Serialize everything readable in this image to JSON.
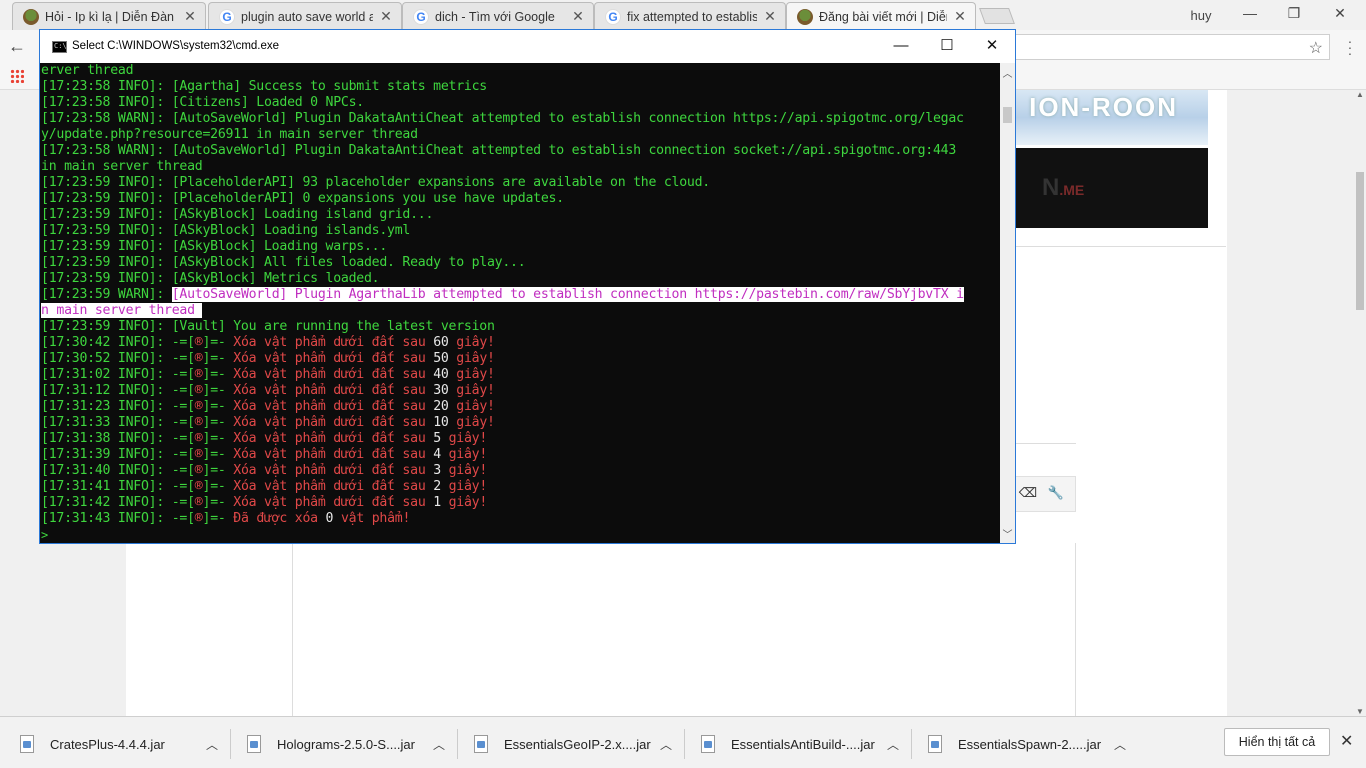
{
  "browser": {
    "tabs": [
      {
        "title": "Hỏi - Ip kì lạ | Diễn Đàn M",
        "favicon": "minecraft-icon"
      },
      {
        "title": "plugin auto save world at",
        "favicon": "google-icon"
      },
      {
        "title": "dich - Tìm với Google",
        "favicon": "google-icon"
      },
      {
        "title": "fix attempted to establish",
        "favicon": "google-icon"
      },
      {
        "title": "Đăng bài viết mới | Diễn Đ",
        "favicon": "minecraft-icon"
      }
    ],
    "profile_name": "huy",
    "window_controls": {
      "minimize": "—",
      "restore": "❐",
      "close": "✕"
    }
  },
  "page": {
    "banner_text": "ION-ROON",
    "banner_sub": "N",
    "banner_me": ".ME"
  },
  "cmd": {
    "title": "Select C:\\WINDOWS\\system32\\cmd.exe",
    "icon_text": "C:\\",
    "controls": {
      "minimize": "—",
      "maximize": "☐",
      "close": "✕"
    },
    "prompt": ">",
    "lines": [
      [
        {
          "t": "erver thread",
          "c": "green"
        }
      ],
      [
        {
          "t": "[17:23:58 INFO]: [Agartha] Success to submit stats metrics",
          "c": "green"
        }
      ],
      [
        {
          "t": "[17:23:58 INFO]: [Citizens] Loaded 0 NPCs.",
          "c": "green"
        }
      ],
      [
        {
          "t": "[17:23:58 WARN]: [AutoSaveWorld] Plugin DakataAntiCheat attempted to establish connection https://api.spigotmc.org/legac",
          "c": "green"
        }
      ],
      [
        {
          "t": "y/update.php?resource=26911 in main server thread",
          "c": "green"
        }
      ],
      [
        {
          "t": "[17:23:58 WARN]: [AutoSaveWorld] Plugin DakataAntiCheat attempted to establish connection socket://api.spigotmc.org:443",
          "c": "green"
        }
      ],
      [
        {
          "t": "in main server thread",
          "c": "green"
        }
      ],
      [
        {
          "t": "[17:23:59 INFO]: [PlaceholderAPI] 93 placeholder expansions are available on the cloud.",
          "c": "green"
        }
      ],
      [
        {
          "t": "[17:23:59 INFO]: [PlaceholderAPI] 0 expansions you use have updates.",
          "c": "green"
        }
      ],
      [
        {
          "t": "[17:23:59 INFO]: [ASkyBlock] Loading island grid...",
          "c": "green"
        }
      ],
      [
        {
          "t": "[17:23:59 INFO]: [ASkyBlock] Loading islands.yml",
          "c": "green"
        }
      ],
      [
        {
          "t": "[17:23:59 INFO]: [ASkyBlock] Loading warps...",
          "c": "green"
        }
      ],
      [
        {
          "t": "[17:23:59 INFO]: [ASkyBlock] All files loaded. Ready to play...",
          "c": "green"
        }
      ],
      [
        {
          "t": "[17:23:59 INFO]: [ASkyBlock] Metrics loaded.",
          "c": "green"
        }
      ],
      [
        {
          "t": "[17:23:59 WARN]: ",
          "c": "green"
        },
        {
          "t": "[AutoSaveWorld] Plugin AgarthaLib attempted to establish connection https://pastebin.com/raw/SbYjbvTX i",
          "c": "selpink"
        }
      ],
      [
        {
          "t": "n main server thread ",
          "c": "selpink"
        }
      ],
      [
        {
          "t": "[17:23:59 INFO]: [Vault] You are running the latest version",
          "c": "green"
        }
      ],
      [
        {
          "t": "[17:30:42 INFO]: -=[",
          "c": "green"
        },
        {
          "t": "®",
          "c": "red"
        },
        {
          "t": "]=- ",
          "c": "green"
        },
        {
          "t": "Xóa vật phẩm dưới đất sau ",
          "c": "red"
        },
        {
          "t": "60",
          "c": "white"
        },
        {
          "t": " giây!",
          "c": "red"
        }
      ],
      [
        {
          "t": "[17:30:52 INFO]: -=[",
          "c": "green"
        },
        {
          "t": "®",
          "c": "red"
        },
        {
          "t": "]=- ",
          "c": "green"
        },
        {
          "t": "Xóa vật phẩm dưới đất sau ",
          "c": "red"
        },
        {
          "t": "50",
          "c": "white"
        },
        {
          "t": " giây!",
          "c": "red"
        }
      ],
      [
        {
          "t": "[17:31:02 INFO]: -=[",
          "c": "green"
        },
        {
          "t": "®",
          "c": "red"
        },
        {
          "t": "]=- ",
          "c": "green"
        },
        {
          "t": "Xóa vật phẩm dưới đất sau ",
          "c": "red"
        },
        {
          "t": "40",
          "c": "white"
        },
        {
          "t": " giây!",
          "c": "red"
        }
      ],
      [
        {
          "t": "[17:31:12 INFO]: -=[",
          "c": "green"
        },
        {
          "t": "®",
          "c": "red"
        },
        {
          "t": "]=- ",
          "c": "green"
        },
        {
          "t": "Xóa vật phẩm dưới đất sau ",
          "c": "red"
        },
        {
          "t": "30",
          "c": "white"
        },
        {
          "t": " giây!",
          "c": "red"
        }
      ],
      [
        {
          "t": "[17:31:23 INFO]: -=[",
          "c": "green"
        },
        {
          "t": "®",
          "c": "red"
        },
        {
          "t": "]=- ",
          "c": "green"
        },
        {
          "t": "Xóa vật phẩm dưới đất sau ",
          "c": "red"
        },
        {
          "t": "20",
          "c": "white"
        },
        {
          "t": " giây!",
          "c": "red"
        }
      ],
      [
        {
          "t": "[17:31:33 INFO]: -=[",
          "c": "green"
        },
        {
          "t": "®",
          "c": "red"
        },
        {
          "t": "]=- ",
          "c": "green"
        },
        {
          "t": "Xóa vật phẩm dưới đất sau ",
          "c": "red"
        },
        {
          "t": "10",
          "c": "white"
        },
        {
          "t": " giây!",
          "c": "red"
        }
      ],
      [
        {
          "t": "[17:31:38 INFO]: -=[",
          "c": "green"
        },
        {
          "t": "®",
          "c": "red"
        },
        {
          "t": "]=- ",
          "c": "green"
        },
        {
          "t": "Xóa vật phẩm dưới đất sau ",
          "c": "red"
        },
        {
          "t": "5",
          "c": "white"
        },
        {
          "t": " giây!",
          "c": "red"
        }
      ],
      [
        {
          "t": "[17:31:39 INFO]: -=[",
          "c": "green"
        },
        {
          "t": "®",
          "c": "red"
        },
        {
          "t": "]=- ",
          "c": "green"
        },
        {
          "t": "Xóa vật phẩm dưới đất sau ",
          "c": "red"
        },
        {
          "t": "4",
          "c": "white"
        },
        {
          "t": " giây!",
          "c": "red"
        }
      ],
      [
        {
          "t": "[17:31:40 INFO]: -=[",
          "c": "green"
        },
        {
          "t": "®",
          "c": "red"
        },
        {
          "t": "]=- ",
          "c": "green"
        },
        {
          "t": "Xóa vật phẩm dưới đất sau ",
          "c": "red"
        },
        {
          "t": "3",
          "c": "white"
        },
        {
          "t": " giây!",
          "c": "red"
        }
      ],
      [
        {
          "t": "[17:31:41 INFO]: -=[",
          "c": "green"
        },
        {
          "t": "®",
          "c": "red"
        },
        {
          "t": "]=- ",
          "c": "green"
        },
        {
          "t": "Xóa vật phẩm dưới đất sau ",
          "c": "red"
        },
        {
          "t": "2",
          "c": "white"
        },
        {
          "t": " giây!",
          "c": "red"
        }
      ],
      [
        {
          "t": "[17:31:42 INFO]: -=[",
          "c": "green"
        },
        {
          "t": "®",
          "c": "red"
        },
        {
          "t": "]=- ",
          "c": "green"
        },
        {
          "t": "Xóa vật phẩm dưới đất sau ",
          "c": "red"
        },
        {
          "t": "1",
          "c": "white"
        },
        {
          "t": " giây!",
          "c": "red"
        }
      ],
      [
        {
          "t": "[17:31:43 INFO]: -=[",
          "c": "green"
        },
        {
          "t": "®",
          "c": "red"
        },
        {
          "t": "]=- ",
          "c": "green"
        },
        {
          "t": "Đã được xóa ",
          "c": "red"
        },
        {
          "t": "0",
          "c": "white"
        },
        {
          "t": " vật phẩm!",
          "c": "red"
        }
      ]
    ]
  },
  "downloads": {
    "items": [
      {
        "name": "CratesPlus-4.4.4.jar"
      },
      {
        "name": "Holograms-2.5.0-S....jar"
      },
      {
        "name": "EssentialsGeoIP-2.x....jar"
      },
      {
        "name": "EssentialsAntiBuild-....jar"
      },
      {
        "name": "EssentialsSpawn-2.....jar"
      }
    ],
    "show_all": "Hiển thị tất cả",
    "close": "✕"
  },
  "colors": {
    "cmd_bg": "#0c0c0c",
    "cmd_green": "#3ed63e",
    "cmd_red": "#e04848",
    "cmd_pink": "#d33ad3",
    "cmd_border": "#2b79d8"
  }
}
